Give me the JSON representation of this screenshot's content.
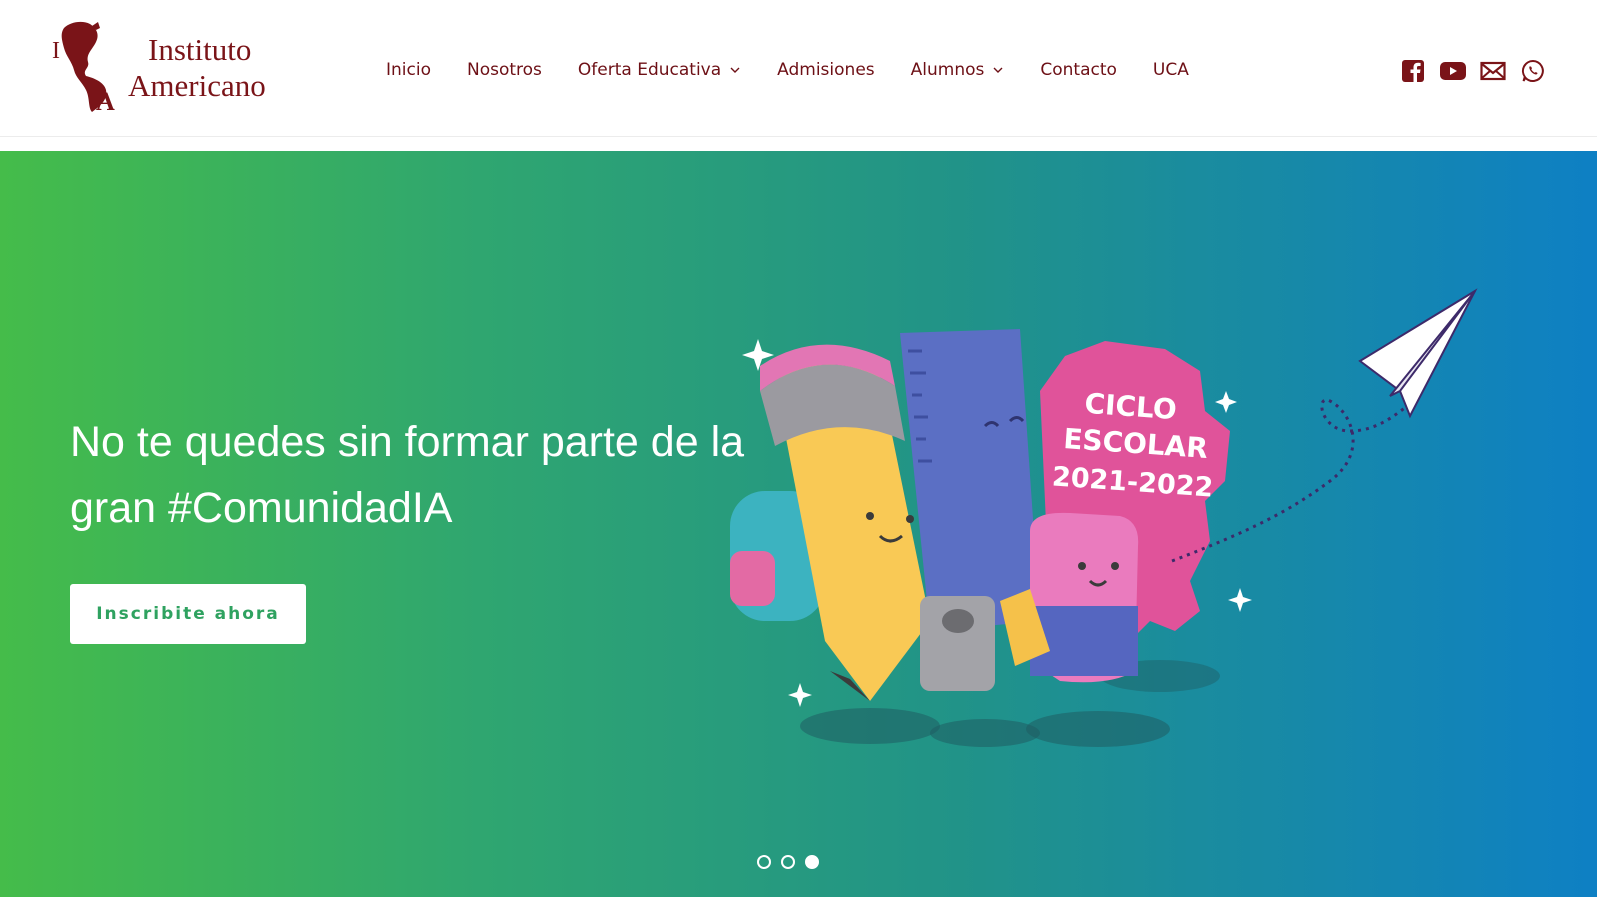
{
  "logo": {
    "line1": "Instituto",
    "line2": "Americano",
    "mark_letters": [
      "I",
      "A"
    ]
  },
  "nav": {
    "items": [
      {
        "label": "Inicio",
        "dropdown": false
      },
      {
        "label": "Nosotros",
        "dropdown": false
      },
      {
        "label": "Oferta Educativa",
        "dropdown": true
      },
      {
        "label": "Admisiones",
        "dropdown": false
      },
      {
        "label": "Alumnos",
        "dropdown": true
      },
      {
        "label": "Contacto",
        "dropdown": false
      },
      {
        "label": "UCA",
        "dropdown": false
      }
    ]
  },
  "social": [
    "facebook-icon",
    "youtube-icon",
    "mail-icon",
    "whatsapp-icon"
  ],
  "hero": {
    "title": "No te quedes sin formar parte de la gran #ComunidadIA",
    "button_label": "Inscribite ahora",
    "banner_text": [
      "CICLO",
      "ESCOLAR",
      "2021-2022"
    ],
    "slides": 3,
    "active_slide": 3
  },
  "colors": {
    "brand": "#7a1418",
    "nav_text": "#6d1016",
    "gradient_start": "#45bc4a",
    "gradient_end": "#0e80c4",
    "button_text": "#2fa260",
    "pink": "#e0539a"
  }
}
